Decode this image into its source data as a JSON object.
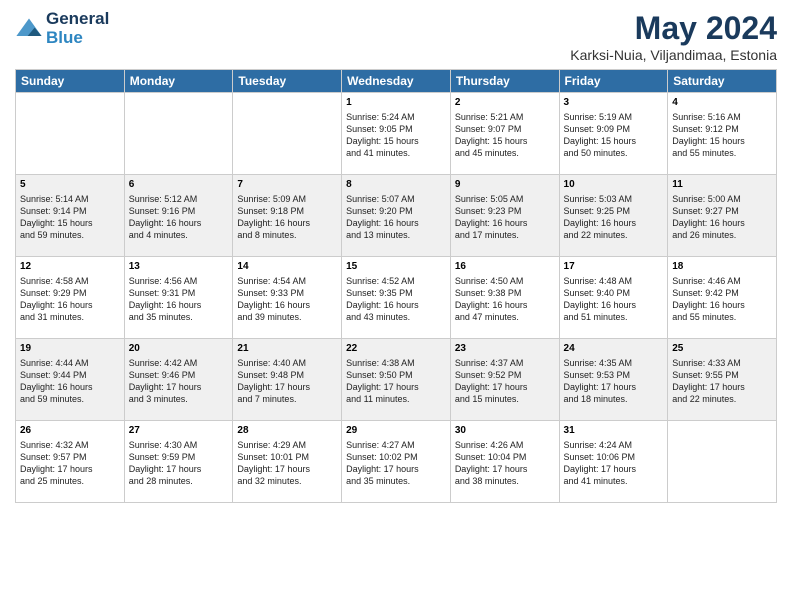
{
  "header": {
    "logo_line1": "General",
    "logo_line2": "Blue",
    "month": "May 2024",
    "location": "Karksi-Nuia, Viljandimaa, Estonia"
  },
  "weekdays": [
    "Sunday",
    "Monday",
    "Tuesday",
    "Wednesday",
    "Thursday",
    "Friday",
    "Saturday"
  ],
  "weeks": [
    [
      {
        "day": "",
        "info": ""
      },
      {
        "day": "",
        "info": ""
      },
      {
        "day": "",
        "info": ""
      },
      {
        "day": "1",
        "info": "Sunrise: 5:24 AM\nSunset: 9:05 PM\nDaylight: 15 hours\nand 41 minutes."
      },
      {
        "day": "2",
        "info": "Sunrise: 5:21 AM\nSunset: 9:07 PM\nDaylight: 15 hours\nand 45 minutes."
      },
      {
        "day": "3",
        "info": "Sunrise: 5:19 AM\nSunset: 9:09 PM\nDaylight: 15 hours\nand 50 minutes."
      },
      {
        "day": "4",
        "info": "Sunrise: 5:16 AM\nSunset: 9:12 PM\nDaylight: 15 hours\nand 55 minutes."
      }
    ],
    [
      {
        "day": "5",
        "info": "Sunrise: 5:14 AM\nSunset: 9:14 PM\nDaylight: 15 hours\nand 59 minutes."
      },
      {
        "day": "6",
        "info": "Sunrise: 5:12 AM\nSunset: 9:16 PM\nDaylight: 16 hours\nand 4 minutes."
      },
      {
        "day": "7",
        "info": "Sunrise: 5:09 AM\nSunset: 9:18 PM\nDaylight: 16 hours\nand 8 minutes."
      },
      {
        "day": "8",
        "info": "Sunrise: 5:07 AM\nSunset: 9:20 PM\nDaylight: 16 hours\nand 13 minutes."
      },
      {
        "day": "9",
        "info": "Sunrise: 5:05 AM\nSunset: 9:23 PM\nDaylight: 16 hours\nand 17 minutes."
      },
      {
        "day": "10",
        "info": "Sunrise: 5:03 AM\nSunset: 9:25 PM\nDaylight: 16 hours\nand 22 minutes."
      },
      {
        "day": "11",
        "info": "Sunrise: 5:00 AM\nSunset: 9:27 PM\nDaylight: 16 hours\nand 26 minutes."
      }
    ],
    [
      {
        "day": "12",
        "info": "Sunrise: 4:58 AM\nSunset: 9:29 PM\nDaylight: 16 hours\nand 31 minutes."
      },
      {
        "day": "13",
        "info": "Sunrise: 4:56 AM\nSunset: 9:31 PM\nDaylight: 16 hours\nand 35 minutes."
      },
      {
        "day": "14",
        "info": "Sunrise: 4:54 AM\nSunset: 9:33 PM\nDaylight: 16 hours\nand 39 minutes."
      },
      {
        "day": "15",
        "info": "Sunrise: 4:52 AM\nSunset: 9:35 PM\nDaylight: 16 hours\nand 43 minutes."
      },
      {
        "day": "16",
        "info": "Sunrise: 4:50 AM\nSunset: 9:38 PM\nDaylight: 16 hours\nand 47 minutes."
      },
      {
        "day": "17",
        "info": "Sunrise: 4:48 AM\nSunset: 9:40 PM\nDaylight: 16 hours\nand 51 minutes."
      },
      {
        "day": "18",
        "info": "Sunrise: 4:46 AM\nSunset: 9:42 PM\nDaylight: 16 hours\nand 55 minutes."
      }
    ],
    [
      {
        "day": "19",
        "info": "Sunrise: 4:44 AM\nSunset: 9:44 PM\nDaylight: 16 hours\nand 59 minutes."
      },
      {
        "day": "20",
        "info": "Sunrise: 4:42 AM\nSunset: 9:46 PM\nDaylight: 17 hours\nand 3 minutes."
      },
      {
        "day": "21",
        "info": "Sunrise: 4:40 AM\nSunset: 9:48 PM\nDaylight: 17 hours\nand 7 minutes."
      },
      {
        "day": "22",
        "info": "Sunrise: 4:38 AM\nSunset: 9:50 PM\nDaylight: 17 hours\nand 11 minutes."
      },
      {
        "day": "23",
        "info": "Sunrise: 4:37 AM\nSunset: 9:52 PM\nDaylight: 17 hours\nand 15 minutes."
      },
      {
        "day": "24",
        "info": "Sunrise: 4:35 AM\nSunset: 9:53 PM\nDaylight: 17 hours\nand 18 minutes."
      },
      {
        "day": "25",
        "info": "Sunrise: 4:33 AM\nSunset: 9:55 PM\nDaylight: 17 hours\nand 22 minutes."
      }
    ],
    [
      {
        "day": "26",
        "info": "Sunrise: 4:32 AM\nSunset: 9:57 PM\nDaylight: 17 hours\nand 25 minutes."
      },
      {
        "day": "27",
        "info": "Sunrise: 4:30 AM\nSunset: 9:59 PM\nDaylight: 17 hours\nand 28 minutes."
      },
      {
        "day": "28",
        "info": "Sunrise: 4:29 AM\nSunset: 10:01 PM\nDaylight: 17 hours\nand 32 minutes."
      },
      {
        "day": "29",
        "info": "Sunrise: 4:27 AM\nSunset: 10:02 PM\nDaylight: 17 hours\nand 35 minutes."
      },
      {
        "day": "30",
        "info": "Sunrise: 4:26 AM\nSunset: 10:04 PM\nDaylight: 17 hours\nand 38 minutes."
      },
      {
        "day": "31",
        "info": "Sunrise: 4:24 AM\nSunset: 10:06 PM\nDaylight: 17 hours\nand 41 minutes."
      },
      {
        "day": "",
        "info": ""
      }
    ]
  ]
}
